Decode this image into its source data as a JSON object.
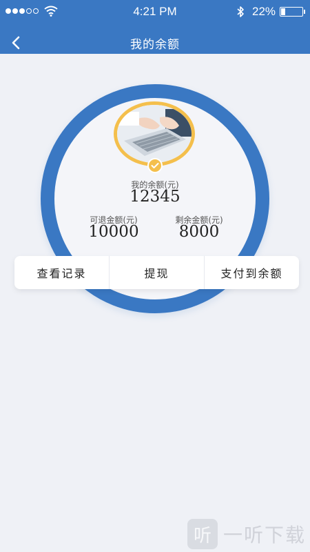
{
  "status": {
    "time": "4:21 PM",
    "battery": "22%",
    "battery_level": 0.22,
    "signal_bars_filled": 3,
    "signal_bars_total": 5
  },
  "nav": {
    "title": "我的余额",
    "back_icon": "chevron-left-icon"
  },
  "balance": {
    "label": "我的余额(元)",
    "value": "12345"
  },
  "refundable": {
    "label": "可退金额(元)",
    "value": "10000"
  },
  "remaining": {
    "label": "剩余金额(元)",
    "value": "8000"
  },
  "actions": [
    {
      "label": "查看记录"
    },
    {
      "label": "提现"
    },
    {
      "label": "支付到余额"
    }
  ],
  "watermark": {
    "glyph": "听",
    "text": "一听下载"
  },
  "colors": {
    "primary": "#3a78c3",
    "accent": "#f4bf4c",
    "background": "#eff1f6"
  }
}
